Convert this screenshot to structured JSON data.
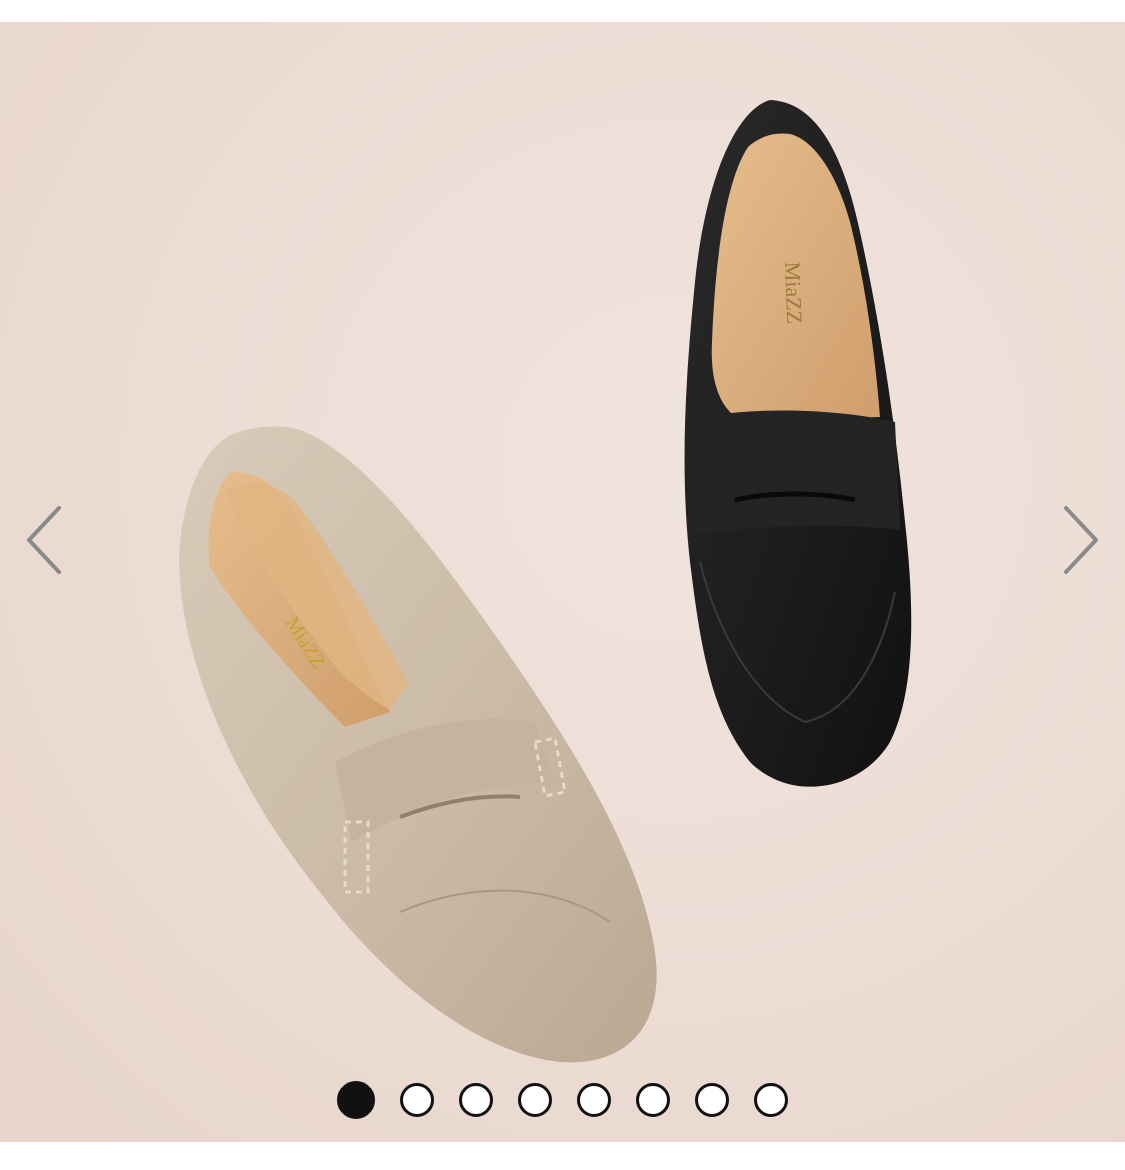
{
  "carousel": {
    "slide_count": 8,
    "active_index": 0,
    "prev_icon": "chevron-left-icon",
    "next_icon": "chevron-right-icon"
  },
  "product_image": {
    "insole_brand_text": "MiaZZ",
    "colors": {
      "background": "#ecdcd4",
      "beige_shoe": "#cbbba6",
      "black_shoe": "#1f1f1f",
      "insole": "#d9ad7c",
      "arrow": "#8a8a8a",
      "dot_active": "#111111"
    }
  }
}
